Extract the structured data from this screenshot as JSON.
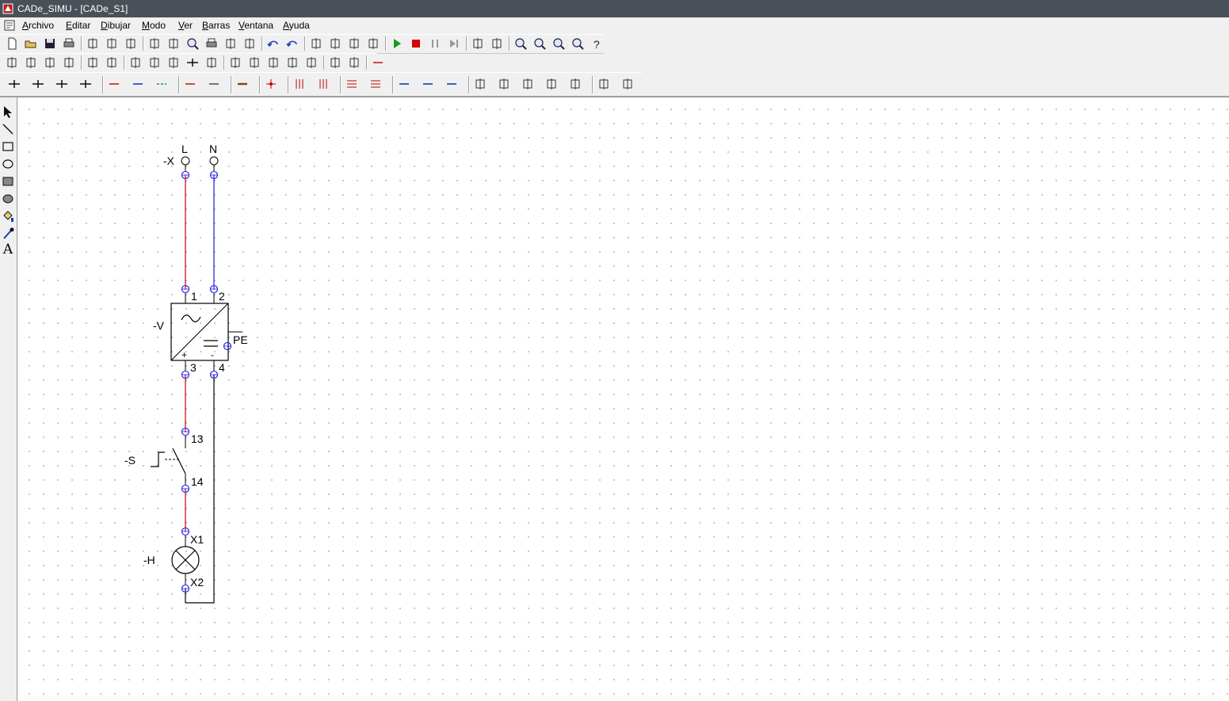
{
  "window": {
    "title": "CADe_SIMU - [CADe_S1]"
  },
  "menu": {
    "items": [
      {
        "id": "archivo",
        "label": "Archivo"
      },
      {
        "id": "editar",
        "label": "Editar"
      },
      {
        "id": "dibujar",
        "label": "Dibujar"
      },
      {
        "id": "modo",
        "label": "Modo"
      },
      {
        "id": "ver",
        "label": "Ver"
      },
      {
        "id": "barras",
        "label": "Barras"
      },
      {
        "id": "ventana",
        "label": "Ventana"
      },
      {
        "id": "ayuda",
        "label": "Ayuda"
      }
    ]
  },
  "toolbars": {
    "standard": [
      "new-file-icon",
      "open-folder-icon",
      "save-icon",
      "print-icon",
      "|",
      "cut-icon",
      "copy-icon",
      "paste-icon",
      "|",
      "find-icon",
      "replace-icon",
      "zoom-search-icon",
      "print-preview-icon",
      "properties-icon",
      "grid-icon",
      "|",
      "undo-icon",
      "redo-icon",
      "|",
      "mirror-horizontal-icon",
      "mirror-vertical-icon",
      "flip-icon",
      "rotate-icon",
      "|",
      "simulate-play-icon",
      "simulate-stop-icon",
      "simulate-pause-icon",
      "simulate-step-icon",
      "|",
      "window-icon",
      "windows-icon",
      "|",
      "zoom-in-icon",
      "zoom-out-icon",
      "zoom-fit-icon",
      "zoom-window-icon",
      "help-icon"
    ],
    "components": [
      "power-supply-icon",
      "fuse-icon",
      "breaker-icon",
      "multipole-breaker-icon",
      "|",
      "motor-icon",
      "transformer-icon",
      "|",
      "contact-no-icon",
      "contact-nc-icon",
      "diode-icon",
      "junction-icon",
      "terminal-icon",
      "|",
      "coil-icon",
      "relay-icon",
      "timer-icon",
      "sensor-icon",
      "plc-icon",
      "|",
      "label-2d-icon",
      "label-3d-icon",
      "|",
      "line-red-icon"
    ],
    "wiring": [
      "junction-1-icon",
      "junction-2-icon",
      "junction-3-icon",
      "junction-4-icon",
      "|",
      "wire-red-icon",
      "wire-blue-icon",
      "wire-green-icon",
      "|",
      "wire-red-2-icon",
      "wire-black-icon",
      "|",
      "bus-icon",
      "|",
      "node-icon",
      "|",
      "vertical-bus-3-icon",
      "vertical-bus-tap-icon",
      "|",
      "horizontal-bus-3-icon",
      "horizontal-bus-tap-icon",
      "|",
      "wire-blue-h-icon",
      "wire-blue-tap-icon",
      "wire-blue-diag-icon",
      "|",
      "connector-1-icon",
      "connector-2-icon",
      "connector-3-icon",
      "connector-4-icon",
      "connector-5-icon",
      "|",
      "plug-male-icon",
      "plug-female-icon"
    ]
  },
  "draw_tools": [
    "select-arrow-icon",
    "line-tool-icon",
    "rectangle-tool-icon",
    "ellipse-tool-icon",
    "filled-rectangle-tool-icon",
    "filled-ellipse-tool-icon",
    "fill-bucket-icon",
    "eyedropper-icon",
    "text-tool-icon"
  ],
  "draw_tools_text_glyph": "A",
  "colors": {
    "wire_phase": "#c00000",
    "wire_neutral": "#1a1ae6",
    "wire_return": "#000000",
    "terminal": "#1a1ae6",
    "titlebar": "#4a5058",
    "canvas_bg": "#ffffff",
    "grid_dot": "#b9b9b9"
  },
  "diagram": {
    "terminal_block": {
      "tag": "-X",
      "pin_l": "L",
      "pin_n": "N"
    },
    "power_supply": {
      "tag": "-V",
      "pin_1": "1",
      "pin_2": "2",
      "pin_3": "3",
      "pin_4": "4",
      "pin_pe": "PE",
      "ac_symbol": "~",
      "dc_symbol": "=",
      "plus": "+",
      "minus": "-"
    },
    "pushbutton": {
      "tag": "-S",
      "pin_13": "13",
      "pin_14": "14"
    },
    "lamp": {
      "tag": "-H",
      "pin_x1": "X1",
      "pin_x2": "X2"
    }
  }
}
